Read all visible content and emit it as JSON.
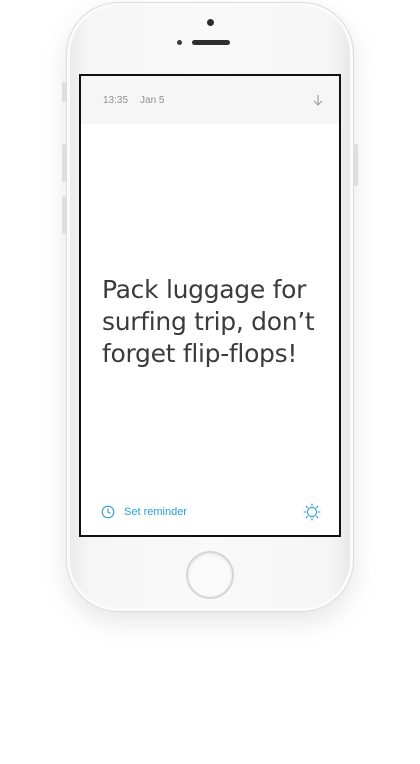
{
  "status_bar": {
    "time": "13:35",
    "date": "Jan 5"
  },
  "icons": {
    "download": "arrow-down-icon",
    "reminder": "clock-icon",
    "theme": "sun-icon"
  },
  "note": {
    "text": "Pack luggage for surfing trip, don’t forget flip-flops!"
  },
  "footer": {
    "reminder_label": "Set reminder"
  },
  "colors": {
    "accent": "#2a9fd6",
    "status_text": "#8f8f8f",
    "note_text": "#3b3b3b"
  }
}
